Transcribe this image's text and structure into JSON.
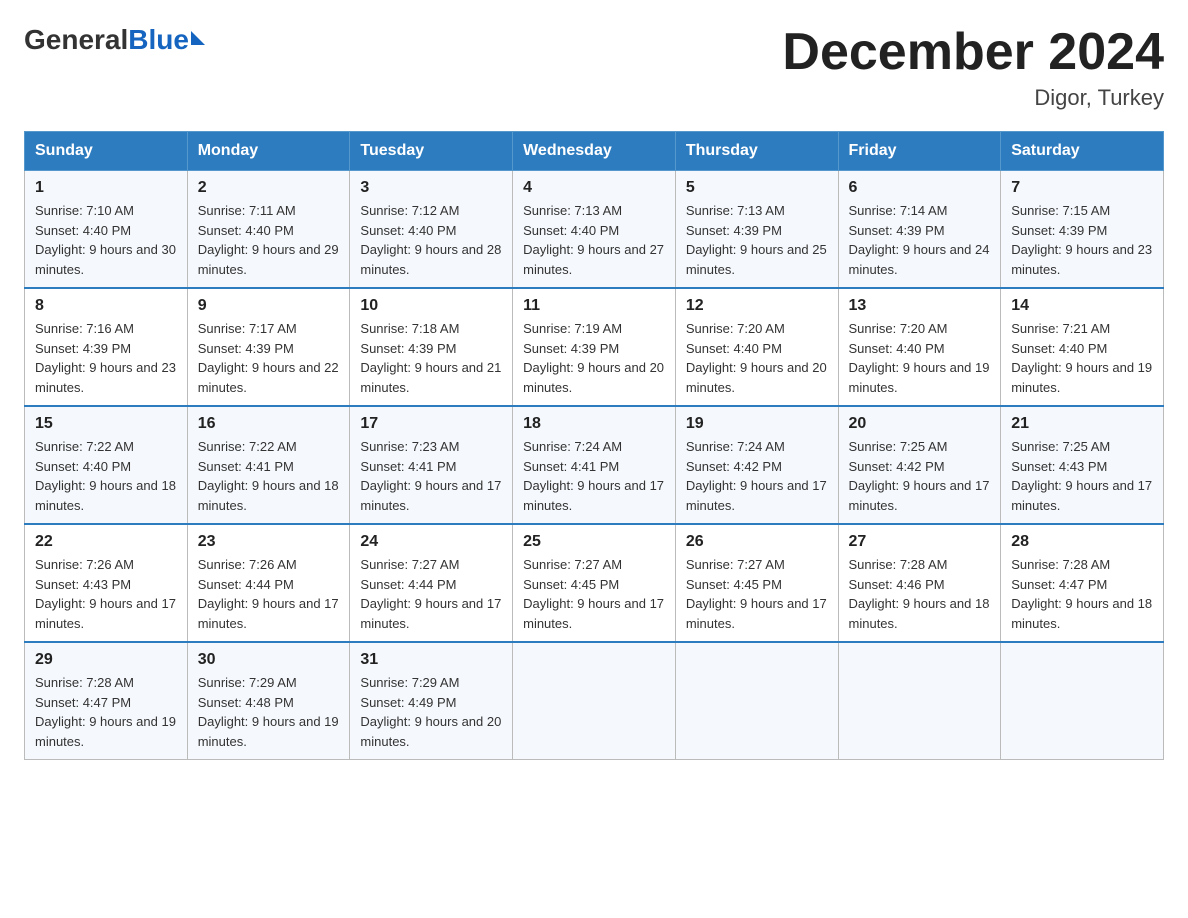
{
  "logo": {
    "general": "General",
    "blue": "Blue",
    "arrow": "▶"
  },
  "header": {
    "month": "December 2024",
    "location": "Digor, Turkey"
  },
  "days_of_week": [
    "Sunday",
    "Monday",
    "Tuesday",
    "Wednesday",
    "Thursday",
    "Friday",
    "Saturday"
  ],
  "weeks": [
    [
      {
        "day": "1",
        "sunrise": "7:10 AM",
        "sunset": "4:40 PM",
        "daylight": "9 hours and 30 minutes."
      },
      {
        "day": "2",
        "sunrise": "7:11 AM",
        "sunset": "4:40 PM",
        "daylight": "9 hours and 29 minutes."
      },
      {
        "day": "3",
        "sunrise": "7:12 AM",
        "sunset": "4:40 PM",
        "daylight": "9 hours and 28 minutes."
      },
      {
        "day": "4",
        "sunrise": "7:13 AM",
        "sunset": "4:40 PM",
        "daylight": "9 hours and 27 minutes."
      },
      {
        "day": "5",
        "sunrise": "7:13 AM",
        "sunset": "4:39 PM",
        "daylight": "9 hours and 25 minutes."
      },
      {
        "day": "6",
        "sunrise": "7:14 AM",
        "sunset": "4:39 PM",
        "daylight": "9 hours and 24 minutes."
      },
      {
        "day": "7",
        "sunrise": "7:15 AM",
        "sunset": "4:39 PM",
        "daylight": "9 hours and 23 minutes."
      }
    ],
    [
      {
        "day": "8",
        "sunrise": "7:16 AM",
        "sunset": "4:39 PM",
        "daylight": "9 hours and 23 minutes."
      },
      {
        "day": "9",
        "sunrise": "7:17 AM",
        "sunset": "4:39 PM",
        "daylight": "9 hours and 22 minutes."
      },
      {
        "day": "10",
        "sunrise": "7:18 AM",
        "sunset": "4:39 PM",
        "daylight": "9 hours and 21 minutes."
      },
      {
        "day": "11",
        "sunrise": "7:19 AM",
        "sunset": "4:39 PM",
        "daylight": "9 hours and 20 minutes."
      },
      {
        "day": "12",
        "sunrise": "7:20 AM",
        "sunset": "4:40 PM",
        "daylight": "9 hours and 20 minutes."
      },
      {
        "day": "13",
        "sunrise": "7:20 AM",
        "sunset": "4:40 PM",
        "daylight": "9 hours and 19 minutes."
      },
      {
        "day": "14",
        "sunrise": "7:21 AM",
        "sunset": "4:40 PM",
        "daylight": "9 hours and 19 minutes."
      }
    ],
    [
      {
        "day": "15",
        "sunrise": "7:22 AM",
        "sunset": "4:40 PM",
        "daylight": "9 hours and 18 minutes."
      },
      {
        "day": "16",
        "sunrise": "7:22 AM",
        "sunset": "4:41 PM",
        "daylight": "9 hours and 18 minutes."
      },
      {
        "day": "17",
        "sunrise": "7:23 AM",
        "sunset": "4:41 PM",
        "daylight": "9 hours and 17 minutes."
      },
      {
        "day": "18",
        "sunrise": "7:24 AM",
        "sunset": "4:41 PM",
        "daylight": "9 hours and 17 minutes."
      },
      {
        "day": "19",
        "sunrise": "7:24 AM",
        "sunset": "4:42 PM",
        "daylight": "9 hours and 17 minutes."
      },
      {
        "day": "20",
        "sunrise": "7:25 AM",
        "sunset": "4:42 PM",
        "daylight": "9 hours and 17 minutes."
      },
      {
        "day": "21",
        "sunrise": "7:25 AM",
        "sunset": "4:43 PM",
        "daylight": "9 hours and 17 minutes."
      }
    ],
    [
      {
        "day": "22",
        "sunrise": "7:26 AM",
        "sunset": "4:43 PM",
        "daylight": "9 hours and 17 minutes."
      },
      {
        "day": "23",
        "sunrise": "7:26 AM",
        "sunset": "4:44 PM",
        "daylight": "9 hours and 17 minutes."
      },
      {
        "day": "24",
        "sunrise": "7:27 AM",
        "sunset": "4:44 PM",
        "daylight": "9 hours and 17 minutes."
      },
      {
        "day": "25",
        "sunrise": "7:27 AM",
        "sunset": "4:45 PM",
        "daylight": "9 hours and 17 minutes."
      },
      {
        "day": "26",
        "sunrise": "7:27 AM",
        "sunset": "4:45 PM",
        "daylight": "9 hours and 17 minutes."
      },
      {
        "day": "27",
        "sunrise": "7:28 AM",
        "sunset": "4:46 PM",
        "daylight": "9 hours and 18 minutes."
      },
      {
        "day": "28",
        "sunrise": "7:28 AM",
        "sunset": "4:47 PM",
        "daylight": "9 hours and 18 minutes."
      }
    ],
    [
      {
        "day": "29",
        "sunrise": "7:28 AM",
        "sunset": "4:47 PM",
        "daylight": "9 hours and 19 minutes."
      },
      {
        "day": "30",
        "sunrise": "7:29 AM",
        "sunset": "4:48 PM",
        "daylight": "9 hours and 19 minutes."
      },
      {
        "day": "31",
        "sunrise": "7:29 AM",
        "sunset": "4:49 PM",
        "daylight": "9 hours and 20 minutes."
      },
      null,
      null,
      null,
      null
    ]
  ]
}
